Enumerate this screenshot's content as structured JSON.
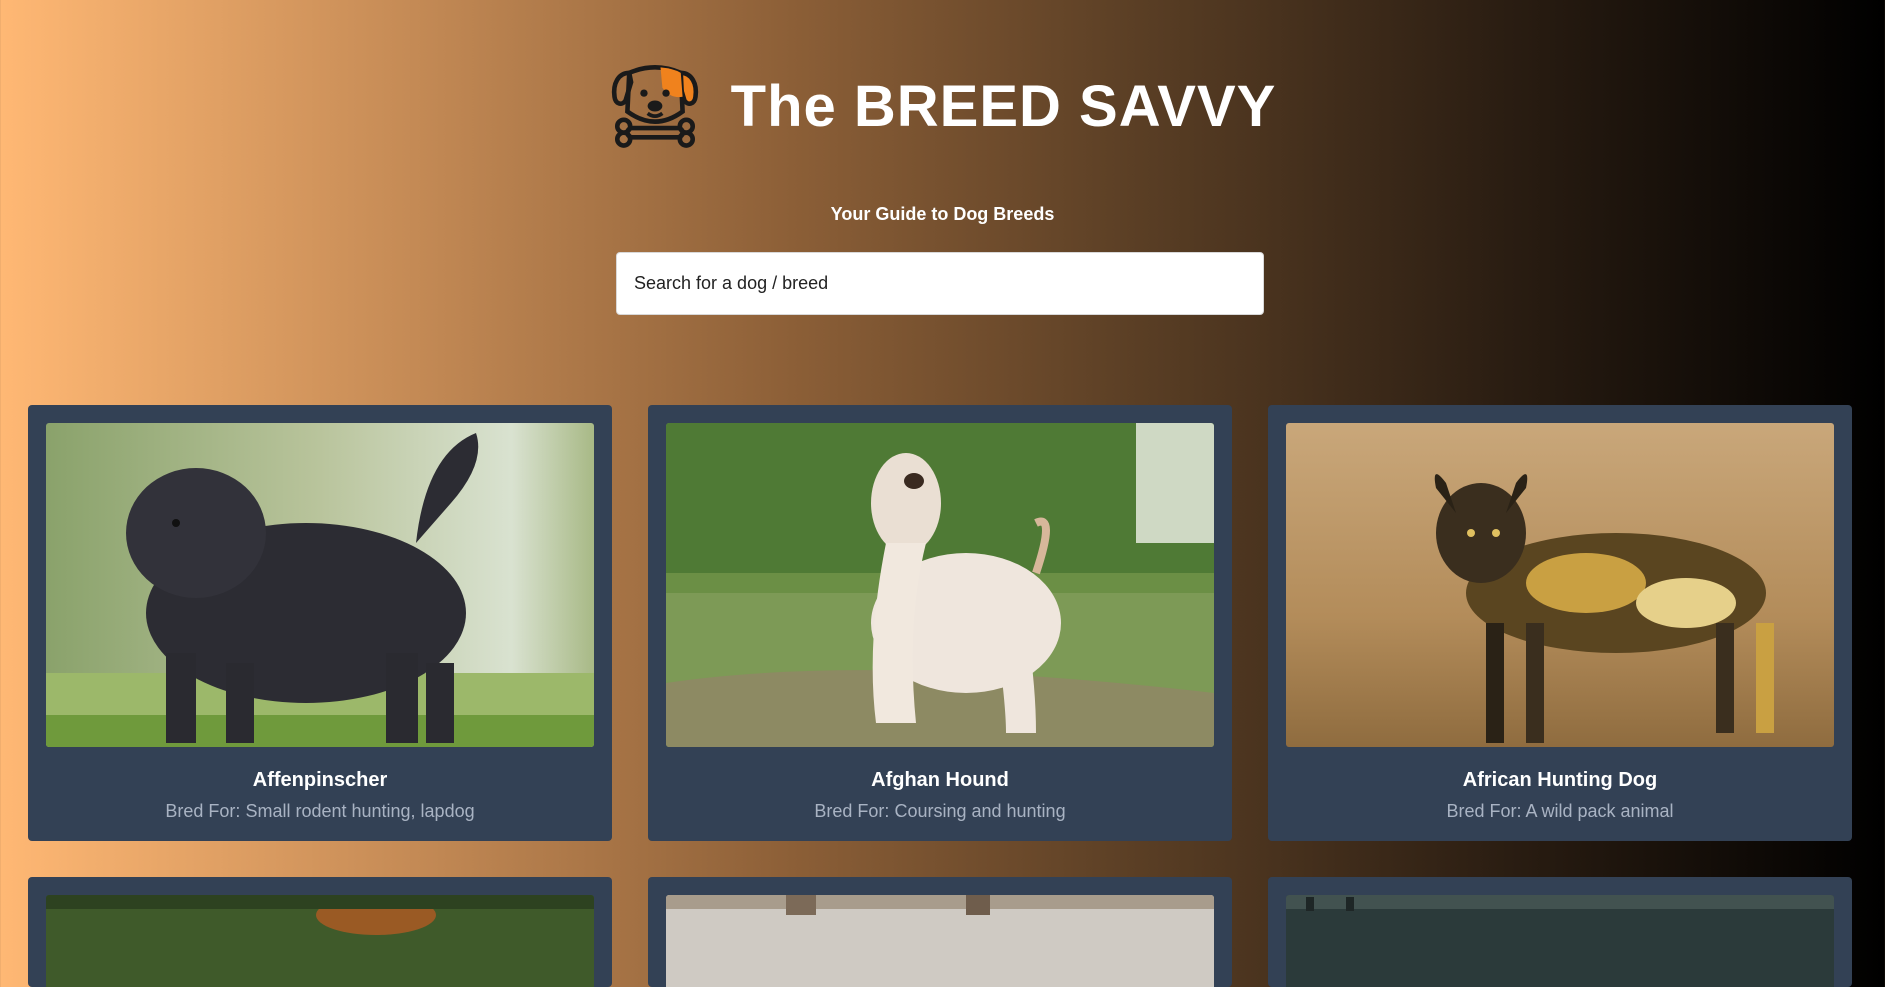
{
  "header": {
    "title": "The BREED SAVVY",
    "subtitle": "Your Guide to Dog Breeds",
    "logo_icon": "dog-bone-logo-icon"
  },
  "search": {
    "placeholder": "Search for a dog / breed",
    "value": ""
  },
  "breeds": [
    {
      "name": "Affenpinscher",
      "bred_for_label": "Bred For:",
      "bred_for": "Small rodent hunting, lapdog",
      "image": "black-shaggy-dog-photo"
    },
    {
      "name": "Afghan Hound",
      "bred_for_label": "Bred For:",
      "bred_for": "Coursing and hunting",
      "image": "white-long-haired-hound-photo"
    },
    {
      "name": "African Hunting Dog",
      "bred_for_label": "Bred For:",
      "bred_for": "A wild pack animal",
      "image": "wild-painted-dog-photo"
    }
  ],
  "colors": {
    "card_bg": "#334155",
    "card_subtext": "#a9b3c3",
    "logo_accent": "#f0821d"
  }
}
